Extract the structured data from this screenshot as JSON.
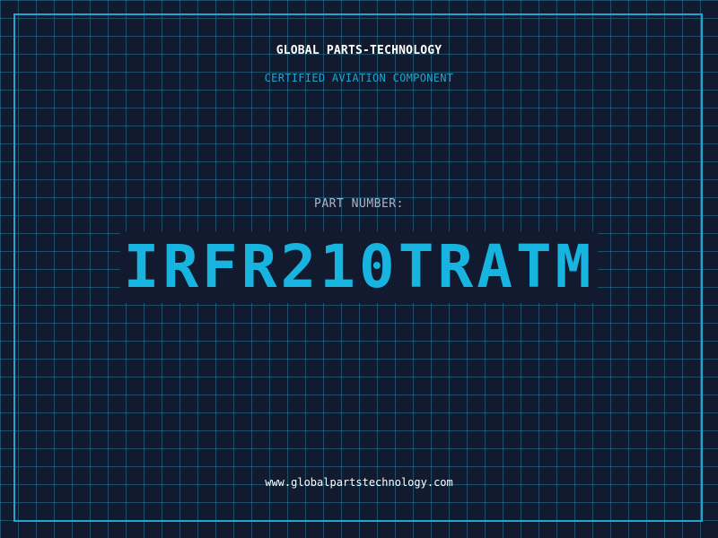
{
  "header": {
    "brand": "GLOBAL PARTS-TECHNOLOGY",
    "tagline": "CERTIFIED AVIATION COMPONENT"
  },
  "main": {
    "part_label": "PART NUMBER:",
    "part_number": "IRFR210TRATM"
  },
  "footer": {
    "website": "www.globalpartstechnology.com"
  },
  "colors": {
    "background": "#111a2e",
    "grid": "#28788f",
    "accent": "#17b4df",
    "text": "#ffffff",
    "muted": "#aab6c6"
  }
}
